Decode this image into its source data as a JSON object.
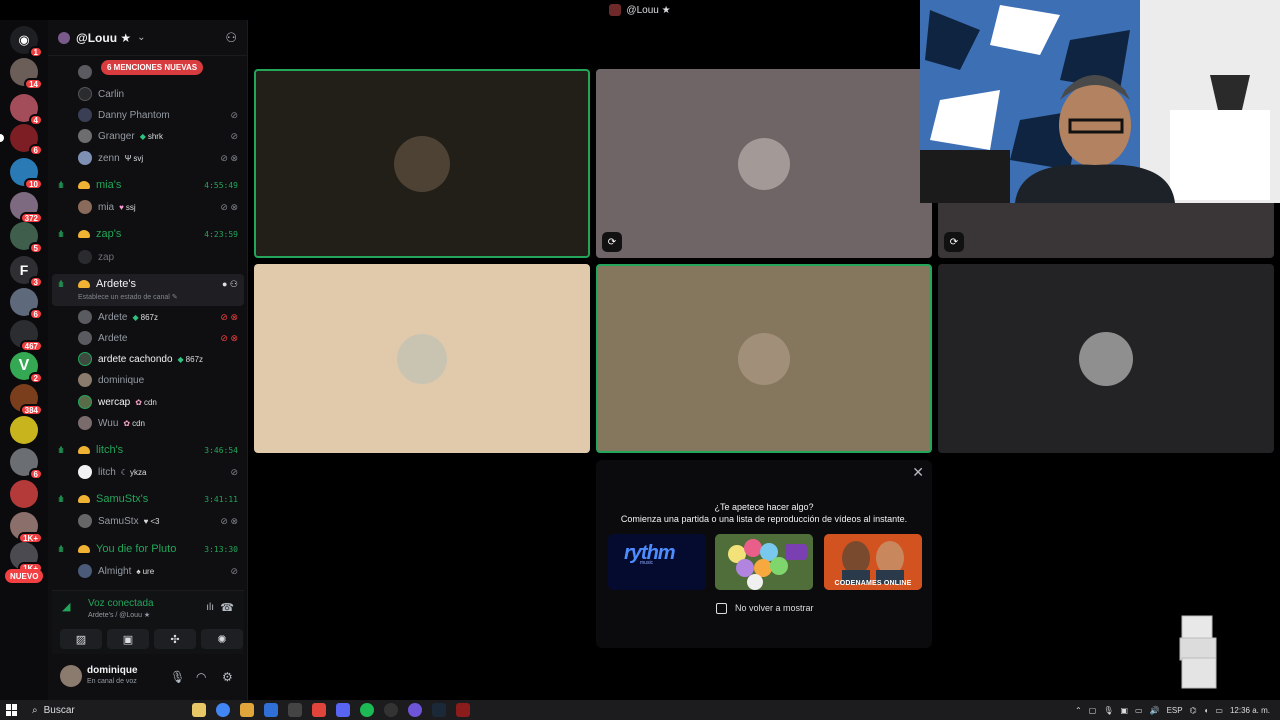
{
  "window": {
    "title": "@Louu ★"
  },
  "rail": {
    "badges": [
      "1",
      "14",
      "4",
      "6",
      "10",
      "372",
      "5",
      "3",
      "6",
      "467",
      "2",
      "384",
      "6",
      "1K+",
      "1K+"
    ],
    "nuevo": "NUEVO"
  },
  "guild": {
    "name": "@Louu ★",
    "mentions": "6 MENCIONES NUEVAS"
  },
  "channels": {
    "members_top": [
      {
        "name": "Carlin",
        "tag": ""
      },
      {
        "name": "Danny Phantom",
        "tag": ""
      },
      {
        "name": "Granger",
        "tag": "shrk"
      },
      {
        "name": "zenn",
        "tag": "svj"
      }
    ],
    "mias": {
      "name": "mia's",
      "timer": "4:55:49",
      "member": "mia",
      "tag": "ssj"
    },
    "zaps": {
      "name": "zap's",
      "timer": "4:23:59",
      "member": "zap"
    },
    "ardete": {
      "name": "Ardete's",
      "status_hint": "Establece un estado de canal",
      "members": [
        {
          "name": "Ardete",
          "tag": "867z"
        },
        {
          "name": "Ardete",
          "tag": ""
        },
        {
          "name": "ardete cachondo",
          "tag": "867z"
        },
        {
          "name": "dominique",
          "tag": ""
        },
        {
          "name": "wercap",
          "tag": "cdn"
        },
        {
          "name": "Wuu",
          "tag": "cdn"
        }
      ]
    },
    "litch": {
      "name": "litch's",
      "timer": "3:46:54",
      "member": "litch",
      "tag": "ykza"
    },
    "samustx": {
      "name": "SamuStx's",
      "timer": "3:41:11",
      "member": "SamuStx",
      "tag": "<3"
    },
    "pluto": {
      "name": "You die for Pluto",
      "timer": "3:13:30",
      "member": "Almight",
      "tag": "ure"
    }
  },
  "voice": {
    "status": "Voz conectada",
    "path": "Ardete's / @Louu ★"
  },
  "user": {
    "name": "dominique",
    "state": "En canal de voz"
  },
  "activity": {
    "title": "¿Te apetece hacer algo?",
    "subtitle": "Comienza una partida o una lista de reproducción de vídeos al instante.",
    "rythm": "rythm",
    "rythm_sub": "music",
    "codenames": "CODENAMES ONLINE",
    "dont_show": "No volver a mostrar"
  },
  "taskbar": {
    "search": "Buscar",
    "lang": "ESP",
    "clock": "12:36 a. m."
  },
  "colors": {
    "speaking": "#23a55a",
    "badge": "#f23f42",
    "voice_green": "#23a55a"
  }
}
